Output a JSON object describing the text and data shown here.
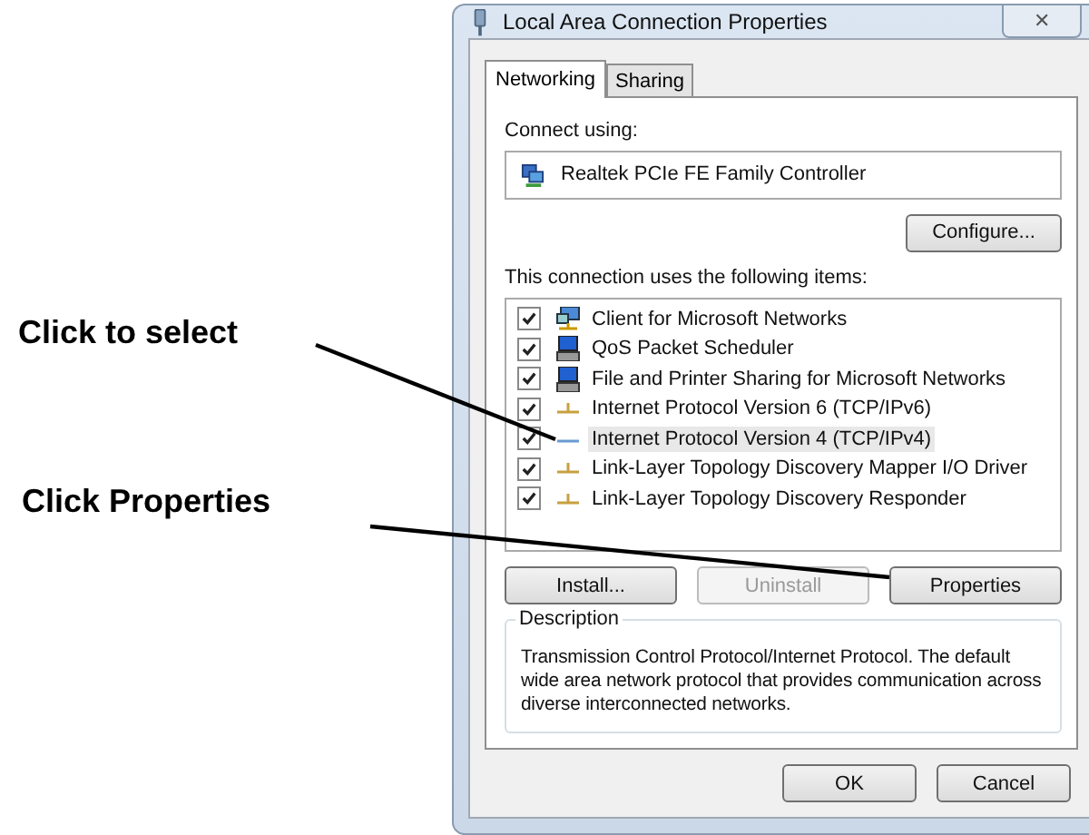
{
  "annotations": [
    {
      "label": "Click to select"
    },
    {
      "label": "Click Properties"
    }
  ],
  "window": {
    "title": "Local Area Connection Properties",
    "close": "✕"
  },
  "tabs": [
    {
      "label": "Networking",
      "selected": true
    },
    {
      "label": "Sharing",
      "selected": false
    }
  ],
  "connect_using": {
    "label": "Connect using:",
    "adapter": "Realtek PCIe FE Family Controller",
    "configure_button": "Configure..."
  },
  "items_label": "This connection uses the following items:",
  "items": [
    {
      "label": "Client for Microsoft Networks",
      "kind": "client",
      "checked": true,
      "selected": false
    },
    {
      "label": "QoS Packet Scheduler",
      "kind": "service",
      "checked": true,
      "selected": false
    },
    {
      "label": "File and Printer Sharing for Microsoft Networks",
      "kind": "service",
      "checked": true,
      "selected": false
    },
    {
      "label": "Internet Protocol Version 6 (TCP/IPv6)",
      "kind": "protocol",
      "checked": true,
      "selected": false
    },
    {
      "label": "Internet Protocol Version 4 (TCP/IPv4)",
      "kind": "protocol",
      "checked": true,
      "selected": true
    },
    {
      "label": "Link-Layer Topology Discovery Mapper I/O Driver",
      "kind": "protocol",
      "checked": true,
      "selected": false
    },
    {
      "label": "Link-Layer Topology Discovery Responder",
      "kind": "protocol",
      "checked": true,
      "selected": false
    }
  ],
  "item_buttons": [
    {
      "label": "Install...",
      "disabled": false
    },
    {
      "label": "Uninstall",
      "disabled": true
    },
    {
      "label": "Properties",
      "disabled": false
    }
  ],
  "description": {
    "legend": "Description",
    "text": "Transmission Control Protocol/Internet Protocol. The default wide area network protocol that provides communication across diverse interconnected networks."
  },
  "buttons": [
    "OK",
    "Cancel"
  ]
}
